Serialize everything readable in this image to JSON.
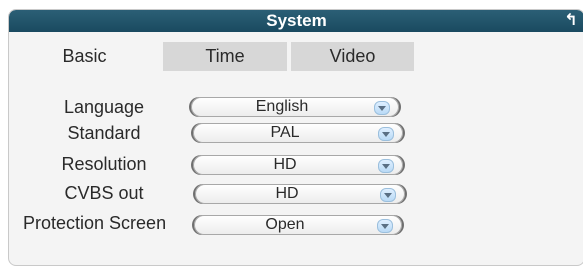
{
  "window": {
    "title": "System"
  },
  "tabs": [
    {
      "label": "Basic"
    },
    {
      "label": "Time"
    },
    {
      "label": "Video"
    }
  ],
  "settings": [
    {
      "label": "Language",
      "value": "English"
    },
    {
      "label": "Standard",
      "value": "PAL"
    },
    {
      "label": "Resolution",
      "value": "HD"
    },
    {
      "label": "CVBS out",
      "value": "HD"
    },
    {
      "label": "Protection Screen",
      "value": "Open"
    }
  ],
  "icons": {
    "back": "return-arrow-icon",
    "dropdown": "dropdown-arrow-icon"
  }
}
